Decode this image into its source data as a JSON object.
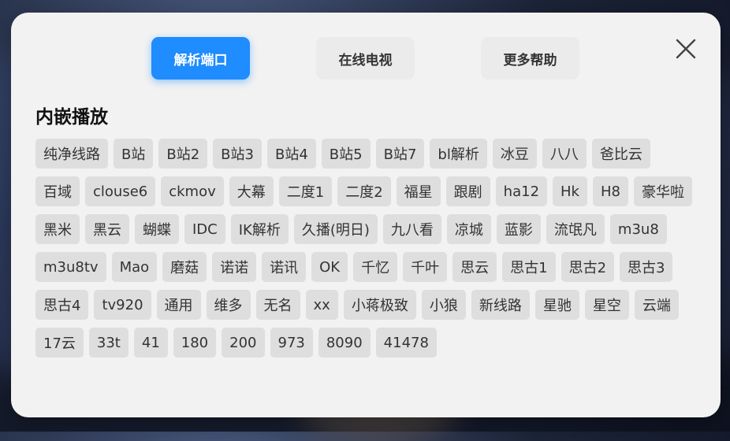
{
  "tabs": [
    {
      "label": "解析端口",
      "active": true
    },
    {
      "label": "在线电视",
      "active": false
    },
    {
      "label": "更多帮助",
      "active": false
    }
  ],
  "close_icon": "close-icon",
  "section_title": "内嵌播放",
  "sources": [
    "纯净线路",
    "B站",
    "B站2",
    "B站3",
    "B站4",
    "B站5",
    "B站7",
    "bl解析",
    "冰豆",
    "八八",
    "爸比云",
    "百域",
    "clouse6",
    "ckmov",
    "大幕",
    "二度1",
    "二度2",
    "福星",
    "跟剧",
    "ha12",
    "Hk",
    "H8",
    "豪华啦",
    "黑米",
    "黑云",
    "蝴蝶",
    "IDC",
    "IK解析",
    "久播(明日)",
    "九八看",
    "凉城",
    "蓝影",
    "流氓凡",
    "m3u8",
    "m3u8tv",
    "Mao",
    "磨菇",
    "诺诺",
    "诺讯",
    "OK",
    "千忆",
    "千叶",
    "思云",
    "思古1",
    "思古2",
    "思古3",
    "思古4",
    "tv920",
    "通用",
    "维多",
    "无名",
    "xx",
    "小蒋极致",
    "小狼",
    "新线路",
    "星驰",
    "星空",
    "云端",
    "17云",
    "33t",
    "41",
    "180",
    "200",
    "973",
    "8090",
    "41478"
  ],
  "colors": {
    "accent": "#1f8cff",
    "dialog_bg": "#f2f2f2",
    "chip_bg": "#dedede",
    "tab_bg": "#ebebeb"
  }
}
